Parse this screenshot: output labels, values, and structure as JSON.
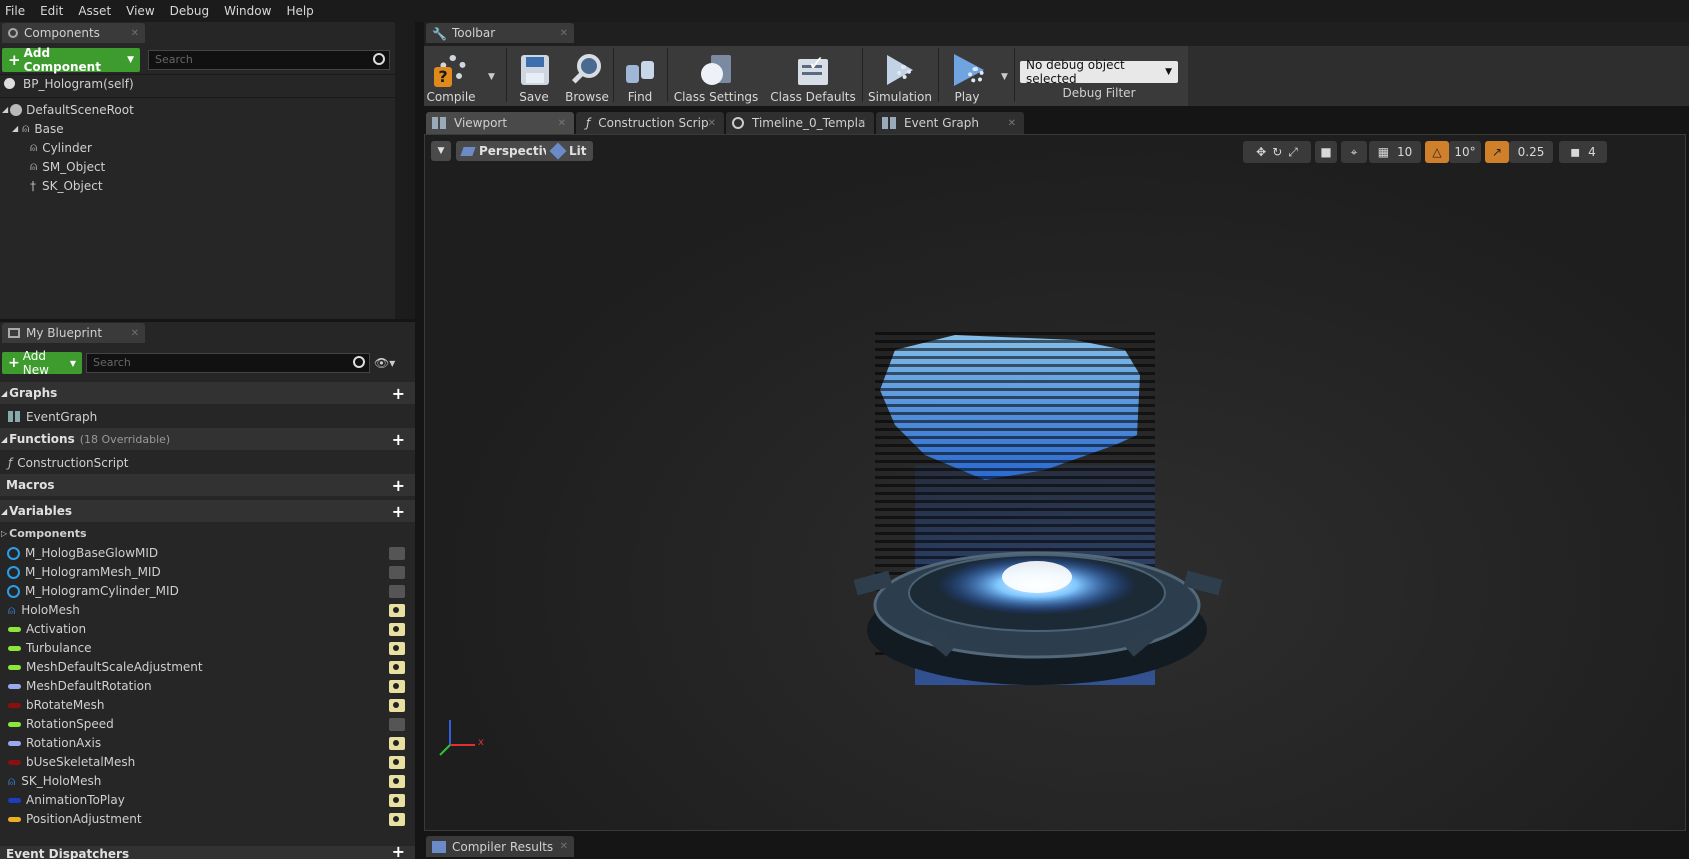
{
  "menu": [
    "File",
    "Edit",
    "Asset",
    "View",
    "Debug",
    "Window",
    "Help"
  ],
  "components_panel": {
    "tab_label": "Components",
    "add_button": "Add Component",
    "search_placeholder": "Search",
    "self_label": "BP_Hologram(self)",
    "tree": [
      {
        "label": "DefaultSceneRoot"
      },
      {
        "label": "Base"
      },
      {
        "label": "Cylinder"
      },
      {
        "label": "SM_Object"
      },
      {
        "label": "SK_Object"
      }
    ]
  },
  "my_blueprint": {
    "tab_label": "My Blueprint",
    "add_button": "Add New",
    "search_placeholder": "Search",
    "graphs_label": "Graphs",
    "event_graph": "EventGraph",
    "functions_label": "Functions",
    "functions_overridable": "(18 Overridable)",
    "construction_script": "ConstructionScript",
    "macros_label": "Macros",
    "variables_label": "Variables",
    "components_label": "Components",
    "variables": [
      {
        "name": "M_HologBaseGlowMID",
        "type": "ring",
        "color": "#2a9ee8",
        "visible": false
      },
      {
        "name": "M_HologramMesh_MID",
        "type": "ring",
        "color": "#2a9ee8",
        "visible": false
      },
      {
        "name": "M_HologramCylinder_MID",
        "type": "ring",
        "color": "#2a9ee8",
        "visible": false
      },
      {
        "name": "HoloMesh",
        "type": "component",
        "color": "#3a8ee0",
        "visible": true
      },
      {
        "name": "Activation",
        "type": "pill",
        "color": "#8ee63a",
        "visible": true
      },
      {
        "name": "Turbulance",
        "type": "pill",
        "color": "#8ee63a",
        "visible": true
      },
      {
        "name": "MeshDefaultScaleAdjustment",
        "type": "pill",
        "color": "#8ee63a",
        "visible": true
      },
      {
        "name": "MeshDefaultRotation",
        "type": "pill",
        "color": "#9aa8f0",
        "visible": true
      },
      {
        "name": "bRotateMesh",
        "type": "pill",
        "color": "#8a1010",
        "visible": true
      },
      {
        "name": "RotationSpeed",
        "type": "pill",
        "color": "#8ee63a",
        "visible": false
      },
      {
        "name": "RotationAxis",
        "type": "pill",
        "color": "#9aa8f0",
        "visible": true
      },
      {
        "name": "bUseSkeletalMesh",
        "type": "pill",
        "color": "#8a1010",
        "visible": true
      },
      {
        "name": "SK_HoloMesh",
        "type": "component",
        "color": "#3a8ee0",
        "visible": true
      },
      {
        "name": "AnimationToPlay",
        "type": "pill",
        "color": "#1d3ec0",
        "visible": true
      },
      {
        "name": "PositionAdjustment",
        "type": "pill",
        "color": "#e8b020",
        "visible": true
      }
    ],
    "event_dispatchers_label": "Event Dispatchers"
  },
  "toolbar": {
    "tab_label": "Toolbar",
    "buttons": [
      {
        "label": "Compile"
      },
      {
        "label": "Save"
      },
      {
        "label": "Browse"
      },
      {
        "label": "Find"
      },
      {
        "label": "Class Settings"
      },
      {
        "label": "Class Defaults"
      },
      {
        "label": "Simulation"
      },
      {
        "label": "Play"
      }
    ],
    "debug_select": "No debug object selected",
    "debug_filter_label": "Debug Filter"
  },
  "editor_tabs": [
    {
      "label": "Viewport"
    },
    {
      "label": "Construction Scrip"
    },
    {
      "label": "Timeline_0_Templa"
    },
    {
      "label": "Event Graph"
    }
  ],
  "viewport": {
    "perspective": "Perspective",
    "lit": "Lit",
    "grid_snap": "10",
    "rotation_snap": "10°",
    "scale_snap": "0.25",
    "camera_speed": "4",
    "axis_x": "x"
  },
  "compiler_tab": "Compiler Results"
}
